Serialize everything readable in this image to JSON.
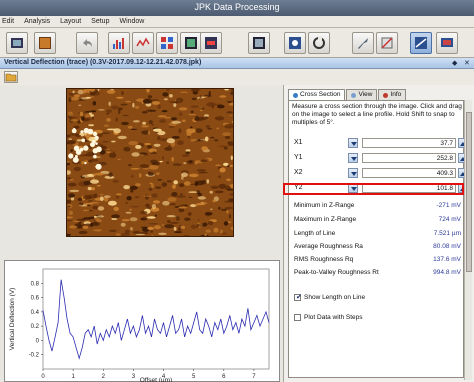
{
  "app": {
    "title": "JPK Data Processing"
  },
  "menu": {
    "items": [
      "Edit",
      "Analysis",
      "Layout",
      "Setup",
      "Window"
    ]
  },
  "window": {
    "title": "Vertical Deflection (trace) (0.3V-2017.09.12-12.21.42.078.jpk)",
    "ctl_pin": "◆",
    "ctl_close": "✕"
  },
  "tabs": [
    {
      "label": "Cross Section",
      "color": "#3a7cc4"
    },
    {
      "label": "View",
      "color": "#7a9fd0"
    },
    {
      "label": "Info",
      "color": "#c0392b"
    }
  ],
  "cross_section": {
    "description": "Measure a cross section through the image. Click and drag on the image to select a line profile. Hold Shift to snap to multiples of 5°.",
    "coords": [
      {
        "label": "X1",
        "value": "37.7"
      },
      {
        "label": "Y1",
        "value": "252.8"
      },
      {
        "label": "X2",
        "value": "409.3"
      },
      {
        "label": "Y2",
        "value": "101.8"
      }
    ],
    "measurements": [
      {
        "label": "Minimum in Z-Range",
        "value": "-271 mV"
      },
      {
        "label": "Maximum in Z-Range",
        "value": "724 mV"
      },
      {
        "label": "Length of Line",
        "value": "7.521 µm"
      },
      {
        "label": "Average Roughness Ra",
        "value": "80.08 mV"
      },
      {
        "label": "RMS Roughness Rq",
        "value": "137.6 mV"
      },
      {
        "label": "Peak-to-Valley Roughness Rt",
        "value": "994.8 mV"
      }
    ],
    "options": [
      {
        "label": "Show Length on Line",
        "checked": true
      },
      {
        "label": "Plot Data with Steps",
        "checked": false
      }
    ]
  },
  "chart_data": {
    "type": "line",
    "xlabel": "Offset (µm)",
    "ylabel": "Vertical Deflection (V)",
    "xlim": [
      0,
      7.5
    ],
    "ylim": [
      -0.4,
      1.0
    ],
    "xticks": [
      "0",
      "1",
      "2",
      "3",
      "4",
      "5",
      "6",
      "7"
    ],
    "yticks": [
      "0.8",
      "0.6",
      "0.4",
      "0.2",
      "0",
      "-0.2"
    ],
    "series": [
      {
        "color": "#2a2ab0",
        "x": [
          0,
          0.1,
          0.2,
          0.3,
          0.4,
          0.5,
          0.6,
          0.7,
          0.8,
          0.9,
          1.0,
          1.1,
          1.2,
          1.3,
          1.4,
          1.5,
          1.6,
          1.7,
          1.8,
          1.9,
          2.0,
          2.1,
          2.2,
          2.3,
          2.4,
          2.5,
          2.6,
          2.7,
          2.8,
          2.9,
          3.0,
          3.1,
          3.2,
          3.3,
          3.4,
          3.5,
          3.6,
          3.7,
          3.8,
          3.9,
          4.0,
          4.1,
          4.2,
          4.3,
          4.4,
          4.5,
          4.6,
          4.7,
          4.8,
          4.9,
          5.0,
          5.1,
          5.2,
          5.3,
          5.4,
          5.5,
          5.6,
          5.7,
          5.8,
          5.9,
          6.0,
          6.1,
          6.2,
          6.3,
          6.4,
          6.5,
          6.6,
          6.7,
          6.8,
          6.9,
          7.0,
          7.1,
          7.2,
          7.3,
          7.4,
          7.5
        ],
        "y": [
          0.42,
          0.2,
          0.0,
          -0.15,
          0.05,
          0.25,
          0.85,
          0.6,
          0.3,
          0.1,
          0.05,
          -0.1,
          -0.25,
          -0.1,
          0.1,
          0.15,
          0.05,
          0.2,
          -0.05,
          0.1,
          0.0,
          0.15,
          0.05,
          0.2,
          0.1,
          0.25,
          0.0,
          0.15,
          0.3,
          0.1,
          0.2,
          0.05,
          0.15,
          0.35,
          0.1,
          0.2,
          0.05,
          0.3,
          0.15,
          0.1,
          0.25,
          0.05,
          0.2,
          0.35,
          0.1,
          0.15,
          0.3,
          0.05,
          0.2,
          0.1,
          0.25,
          0.4,
          0.15,
          0.1,
          0.3,
          0.2,
          0.05,
          0.25,
          0.15,
          0.3,
          0.1,
          0.2,
          0.35,
          0.15,
          0.25,
          0.1,
          0.3,
          0.2,
          0.45,
          0.15,
          0.25,
          0.35,
          0.2,
          0.3,
          0.4,
          0.25
        ]
      }
    ]
  }
}
